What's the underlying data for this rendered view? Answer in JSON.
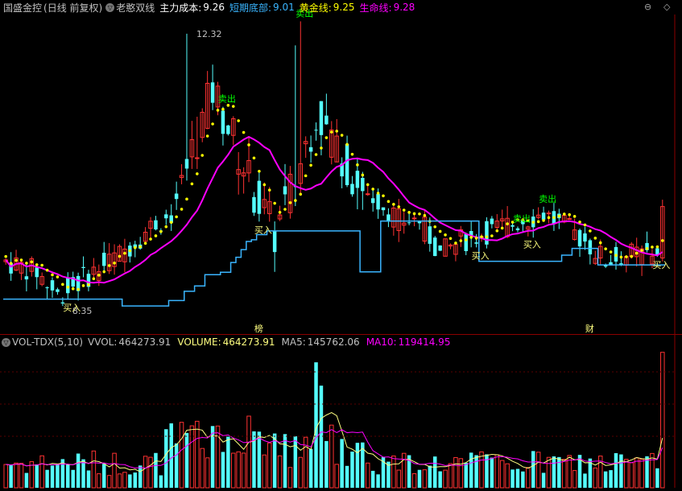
{
  "header": {
    "stock_name": "国盛金控",
    "period": "(日线 前复权)",
    "indicator": "老憨双线",
    "main_cost_label": "主力成本:",
    "main_cost_value": "9.26",
    "short_bottom_label": "短期底部:",
    "short_bottom_value": "9.01",
    "gold_label": "黄金线:",
    "gold_value": "9.25",
    "life_label": "生命线:",
    "life_value": "9.28"
  },
  "vol_header": {
    "name": "VOL-TDX(5,10)",
    "vvol_label": "VVOL:",
    "vvol_value": "464273.91",
    "volume_label": "VOLUME:",
    "volume_value": "464273.91",
    "ma5_label": "MA5:",
    "ma5_value": "145762.06",
    "ma10_label": "MA10:",
    "ma10_value": "119414.95"
  },
  "colors": {
    "up": "#ff3232",
    "down": "#54fcfc",
    "magenta": "#ff00ff",
    "yellow": "#ffff00",
    "cyan_line": "#3ab5ff",
    "ma5": "#ffff80",
    "ma10": "#ff00ff",
    "sell": "#00ff00",
    "buy": "#ffff80"
  },
  "chart_data": {
    "type": "candlestick",
    "price_range": [
      8.0,
      12.6
    ],
    "volume_range": [
      0,
      480000
    ],
    "high_label": "12.32",
    "low_label": "8.35",
    "markers": [
      {
        "text": "买入",
        "index": 12,
        "type": "buy"
      },
      {
        "text": "卖出",
        "index": 42,
        "type": "sell"
      },
      {
        "text": "买入",
        "index": 49,
        "type": "buy"
      },
      {
        "text": "卖出",
        "index": 57,
        "type": "sell"
      },
      {
        "text": "买入",
        "index": 91,
        "type": "buy"
      },
      {
        "text": "卖出",
        "index": 99,
        "type": "sell"
      },
      {
        "text": "买入",
        "index": 101,
        "type": "buy"
      },
      {
        "text": "卖出",
        "index": 104,
        "type": "sell"
      },
      {
        "text": "买入",
        "index": 126,
        "type": "buy"
      }
    ],
    "events": [
      {
        "text": "榜",
        "index": 49
      },
      {
        "text": "财",
        "index": 113
      }
    ],
    "candles": []
  },
  "icons": {
    "circle_icon": "▽",
    "restore_icon": "◇",
    "minimize_icon": "⊖"
  }
}
